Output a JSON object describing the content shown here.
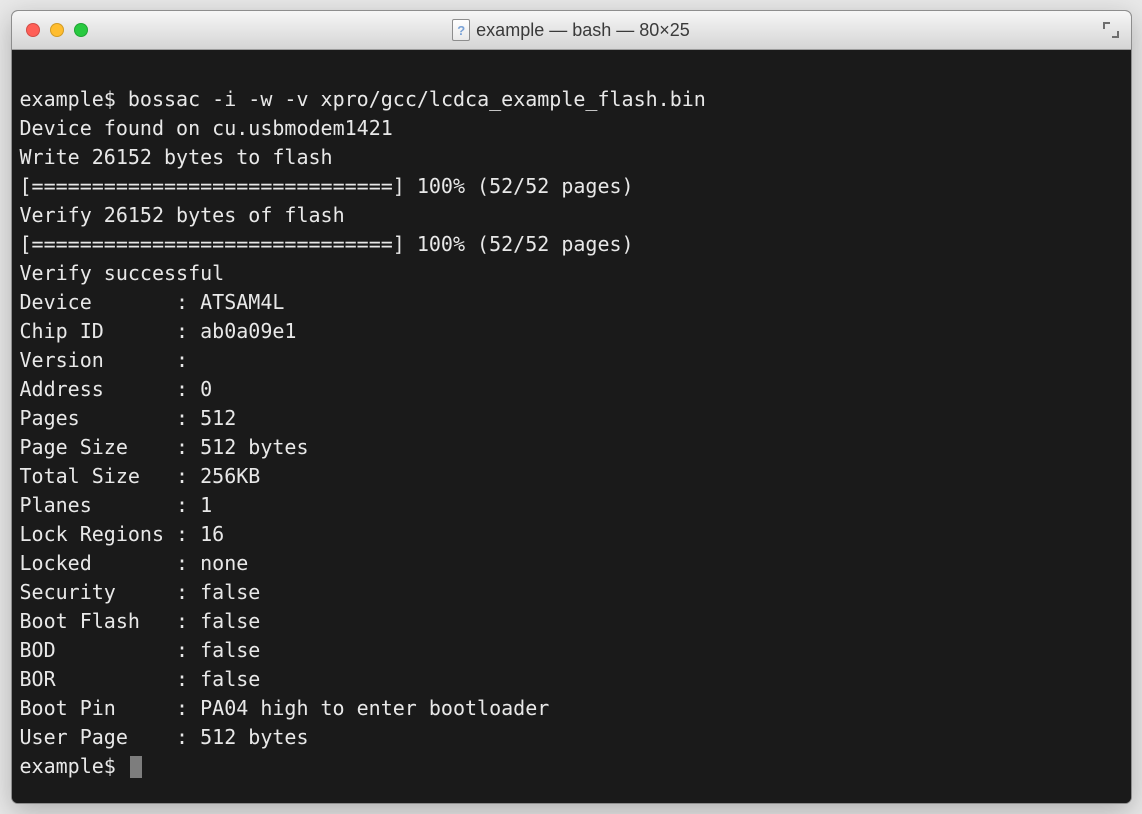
{
  "window": {
    "title": "example — bash — 80×25",
    "doc_icon_char": "?"
  },
  "terminal": {
    "prompt": "example$",
    "command": "bossac -i -w -v xpro/gcc/lcdca_example_flash.bin",
    "device_line": "Device found on cu.usbmodem1421",
    "write_line": "Write 26152 bytes to flash",
    "write_progress": "[==============================] 100% (52/52 pages)",
    "verify_line": "Verify 26152 bytes of flash",
    "verify_progress": "[==============================] 100% (52/52 pages)",
    "verify_success": "Verify successful",
    "info": [
      {
        "key": "Device",
        "value": "ATSAM4L"
      },
      {
        "key": "Chip ID",
        "value": "ab0a09e1"
      },
      {
        "key": "Version",
        "value": ""
      },
      {
        "key": "Address",
        "value": "0"
      },
      {
        "key": "Pages",
        "value": "512"
      },
      {
        "key": "Page Size",
        "value": "512 bytes"
      },
      {
        "key": "Total Size",
        "value": "256KB"
      },
      {
        "key": "Planes",
        "value": "1"
      },
      {
        "key": "Lock Regions",
        "value": "16"
      },
      {
        "key": "Locked",
        "value": "none"
      },
      {
        "key": "Security",
        "value": "false"
      },
      {
        "key": "Boot Flash",
        "value": "false"
      },
      {
        "key": "BOD",
        "value": "false"
      },
      {
        "key": "BOR",
        "value": "false"
      },
      {
        "key": "Boot Pin",
        "value": "PA04 high to enter bootloader"
      },
      {
        "key": "User Page",
        "value": "512 bytes"
      }
    ]
  }
}
